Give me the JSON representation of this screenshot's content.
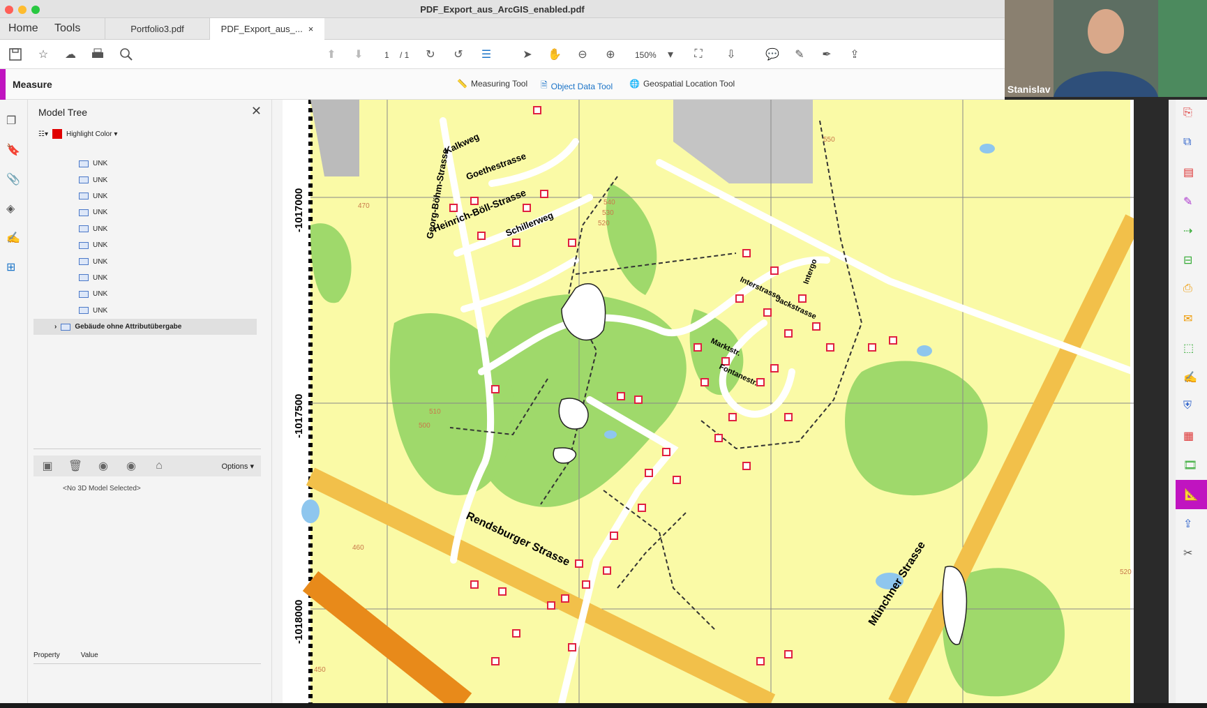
{
  "window": {
    "title": "PDF_Export_aus_ArcGIS_enabled.pdf"
  },
  "nav": {
    "home": "Home",
    "tools": "Tools"
  },
  "tabs": [
    {
      "label": "Portfolio3.pdf"
    },
    {
      "label": "PDF_Export_aus_...",
      "close": "×"
    }
  ],
  "toolbar": {
    "page_current": "1",
    "page_total": "/ 1",
    "zoom": "150%"
  },
  "measure": {
    "title": "Measure",
    "tools": [
      "Measuring Tool",
      "Object Data Tool",
      "Geospatial Location Tool"
    ]
  },
  "panel": {
    "title": "Model Tree",
    "close": "✕",
    "highlight_label": "Highlight Color ▾",
    "highlight_color": "#e00000",
    "tree_items": [
      "UNK",
      "UNK",
      "UNK",
      "UNK",
      "UNK",
      "UNK",
      "UNK",
      "UNK",
      "UNK",
      "UNK"
    ],
    "tree_last": "Gebäude ohne Attributübergabe",
    "options": "Options ▾",
    "no_model": "<No 3D Model Selected>",
    "property_header": "Property",
    "value_header": "Value"
  },
  "map": {
    "streets": [
      "Georg-Böhm-Strasse",
      "Kalkweg",
      "Goethestrasse",
      "Heinrich-Böll-Strasse",
      "Schillerweg",
      "Rendsburger Strasse",
      "Münchner Strasse",
      "Jackstrasse",
      "Intergo",
      "Interstrasse",
      "Fontanestr.",
      "Marktstr."
    ],
    "grid_labels": [
      "-1017000",
      "-1017500",
      "-1018000"
    ],
    "contour_labels": [
      "540",
      "530",
      "520",
      "550",
      "470",
      "460",
      "450",
      "500",
      "510",
      "520"
    ]
  },
  "webcam": {
    "name": "Stanislav"
  },
  "colors": {
    "accent": "#c014c0",
    "link": "#1a73c7",
    "map_bg": "#fafaa6",
    "forest": "#9fd96b",
    "building": "#e02040",
    "road": "#f2c04a"
  }
}
